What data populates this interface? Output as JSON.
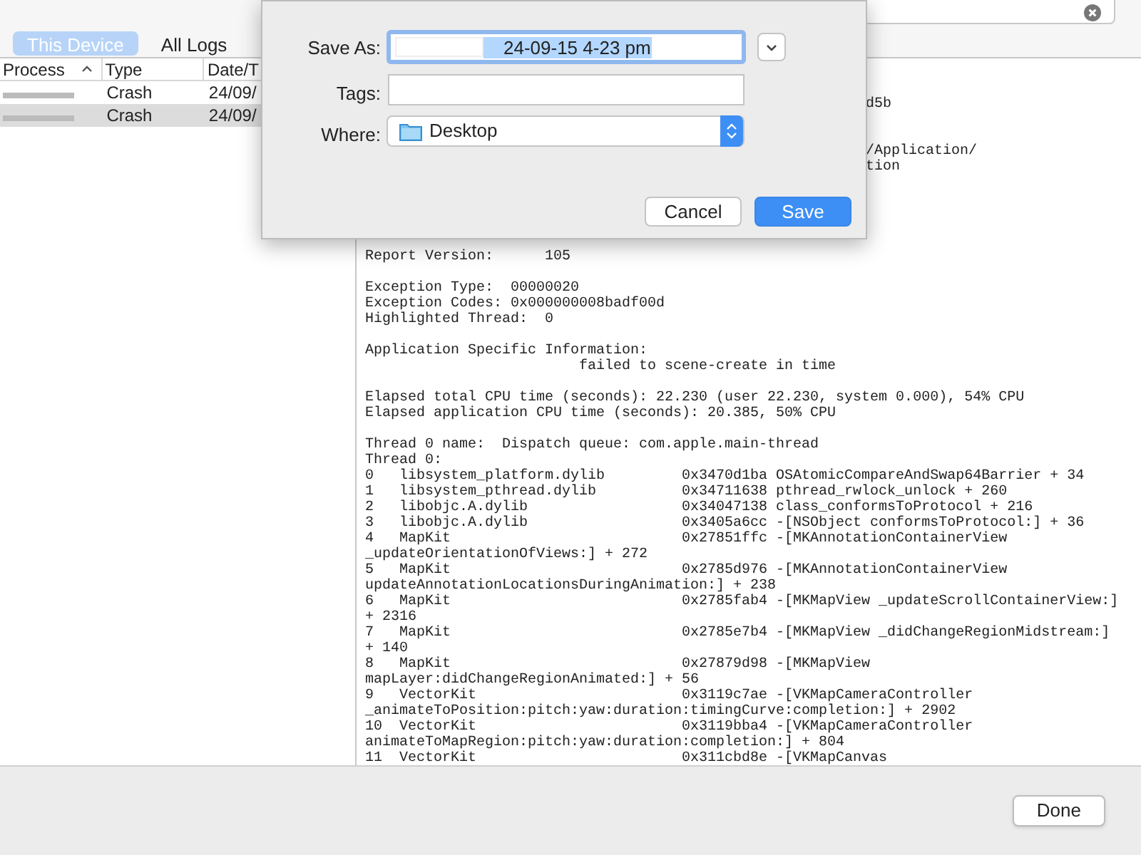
{
  "tabs": [
    {
      "label": "This Device",
      "selected": true
    },
    {
      "label": "All Logs",
      "selected": false
    }
  ],
  "table": {
    "columns": [
      {
        "label": "Process",
        "sorted": true
      },
      {
        "label": "Type",
        "sorted": false
      },
      {
        "label": "Date/T"
      }
    ],
    "rows": [
      {
        "type": "Crash",
        "date": "24/09/",
        "selected": false
      },
      {
        "type": "Crash",
        "date": "24/09/",
        "selected": true
      }
    ]
  },
  "log": {
    "fragments": [
      "d5b",
      "/Application/",
      "tion"
    ],
    "paragraphs": [
      [
        "Report Version:      105"
      ],
      [
        "Exception Type:  00000020",
        "Exception Codes: 0x000000008badf00d",
        "Highlighted Thread:  0"
      ],
      [
        "Application Specific Information:",
        "                         failed to scene-create in time"
      ],
      [
        "Elapsed total CPU time (seconds): 22.230 (user 22.230, system 0.000), 54% CPU",
        "Elapsed application CPU time (seconds): 20.385, 50% CPU"
      ],
      [
        "Thread 0 name:  Dispatch queue: com.apple.main-thread",
        "Thread 0:",
        "0   libsystem_platform.dylib         0x3470d1ba OSAtomicCompareAndSwap64Barrier + 34",
        "1   libsystem_pthread.dylib          0x34711638 pthread_rwlock_unlock + 260",
        "2   libobjc.A.dylib                  0x34047138 class_conformsToProtocol + 216",
        "3   libobjc.A.dylib                  0x3405a6cc -[NSObject conformsToProtocol:] + 36",
        "4   MapKit                           0x27851ffc -[MKAnnotationContainerView",
        "_updateOrientationOfViews:] + 272",
        "5   MapKit                           0x2785d976 -[MKAnnotationContainerView",
        "updateAnnotationLocationsDuringAnimation:] + 238",
        "6   MapKit                           0x2785fab4 -[MKMapView _updateScrollContainerView:]",
        "+ 2316",
        "7   MapKit                           0x2785e7b4 -[MKMapView _didChangeRegionMidstream:]",
        "+ 140",
        "8   MapKit                           0x27879d98 -[MKMapView",
        "mapLayer:didChangeRegionAnimated:] + 56",
        "9   VectorKit                        0x3119c7ae -[VKMapCameraController",
        "_animateToPosition:pitch:yaw:duration:timingCurve:completion:] + 2902",
        "10  VectorKit                        0x3119bba4 -[VKMapCameraController",
        "animateToMapRegion:pitch:yaw:duration:completion:] + 804",
        "11  VectorKit                        0x311cbd8e -[VKMapCanvas"
      ]
    ]
  },
  "dialog": {
    "save_as_label": "Save As:",
    "save_as_value": "24-09-15 4-23 pm",
    "tags_label": "Tags:",
    "where_label": "Where:",
    "where_value": "Desktop",
    "buttons": [
      {
        "label": "Cancel",
        "kind": "secondary"
      },
      {
        "label": "Save",
        "kind": "default"
      }
    ]
  },
  "footer": {
    "button": "Done"
  }
}
